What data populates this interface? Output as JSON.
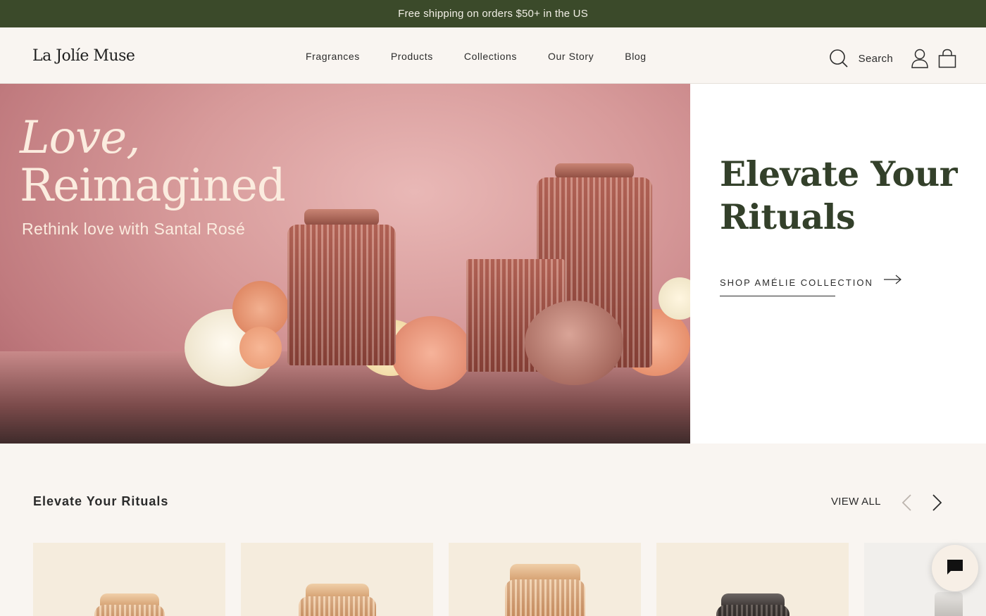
{
  "announcement": "Free shipping on orders $50+ in the US",
  "brand": "La Jolíe Muse",
  "nav": [
    "Fragrances",
    "Products",
    "Collections",
    "Our Story",
    "Blog"
  ],
  "search_label": "Search",
  "hero": {
    "script_line": "Love,",
    "title": "Reimagined",
    "subtitle": "Rethink love with Santal Rosé"
  },
  "panel": {
    "title": "Elevate Your Rituals",
    "cta": "SHOP AMÉLIE COLLECTION"
  },
  "section": {
    "title": "Elevate Your Rituals",
    "view_all": "VIEW ALL"
  },
  "colors": {
    "announcement_bg": "#3b4a2a",
    "panel_heading": "#33402a",
    "page_bg": "#f9f5f1",
    "card_bg": "#f5ecdd"
  },
  "icons": [
    "search-icon",
    "account-icon",
    "bag-icon",
    "arrow-right-icon",
    "chevron-left-icon",
    "chevron-right-icon",
    "chat-icon"
  ]
}
